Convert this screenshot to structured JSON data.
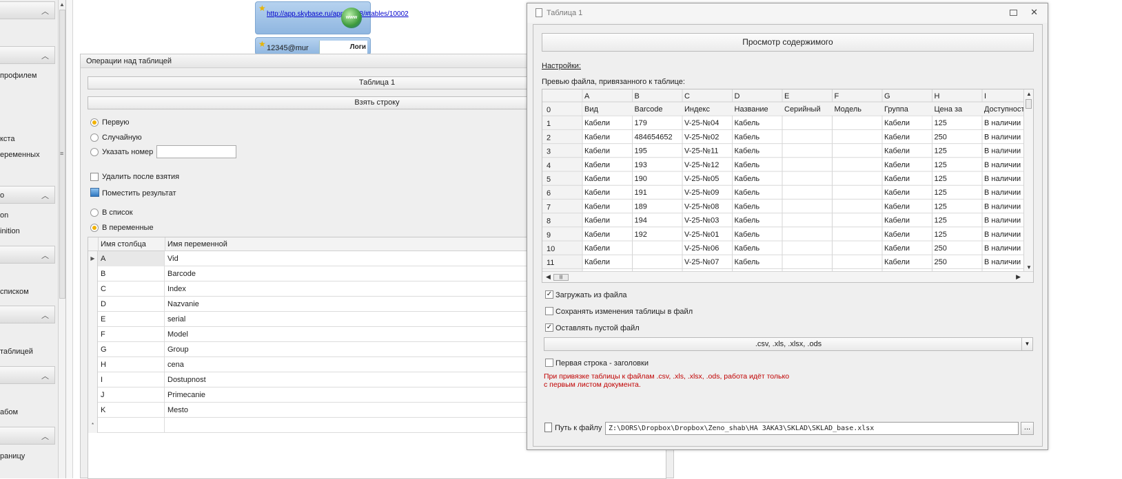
{
  "sidebar": {
    "items": [
      "профилем",
      "кста",
      "еременных",
      "о",
      "on",
      "inition",
      "списком",
      "таблицей",
      "абом",
      "раницу"
    ]
  },
  "cards": {
    "link": "http://app.skybase.ru/app27378/#tables/10002",
    "globe": "www",
    "user": "12345@mur",
    "login": "Логи"
  },
  "ops": {
    "title": "Операции над таблицей",
    "table_name": "Таблица 1",
    "take_row": "Взять строку",
    "radio_first": "Первую",
    "radio_random": "Случайную",
    "radio_number": "Указать номер",
    "delete_after": "Удалить после взятия",
    "put_result": "Поместить результат",
    "to_list": "В список",
    "to_vars": "В переменные",
    "grid_headers": [
      "Имя столбца",
      "Имя переменной"
    ],
    "grid_rows": [
      [
        "A",
        "Vid"
      ],
      [
        "B",
        "Barcode"
      ],
      [
        "C",
        "Index"
      ],
      [
        "D",
        "Nazvanie"
      ],
      [
        "E",
        "serial"
      ],
      [
        "F",
        "Model"
      ],
      [
        "G",
        "Group"
      ],
      [
        "H",
        "cena"
      ],
      [
        "I",
        "Dostupnost"
      ],
      [
        "J",
        "Primecanie"
      ],
      [
        "K",
        "Mesto"
      ]
    ],
    "new_row_marker": "*"
  },
  "dialog": {
    "title": "Таблица 1",
    "view_button": "Просмотр содержимого",
    "settings_link": "Настройки:",
    "preview_label": "Превью файла, привязанного к таблице:",
    "preview": {
      "col_letters": [
        "A",
        "B",
        "C",
        "D",
        "E",
        "F",
        "G",
        "H",
        "I"
      ],
      "row_numbers": [
        "0",
        "1",
        "2",
        "3",
        "4",
        "5",
        "6",
        "7",
        "8",
        "9",
        "10",
        "11"
      ],
      "rows": [
        [
          "Вид",
          "Barcode",
          "Индекс",
          "Название",
          "Серийный",
          "Модель",
          "Группа",
          "Цена за",
          "Доступност"
        ],
        [
          "Кабели",
          "179",
          "V-25-№04",
          "Кабель",
          "",
          "",
          "Кабели",
          "125",
          "В наличии"
        ],
        [
          "Кабели",
          "484654652",
          "V-25-№02",
          "Кабель",
          "",
          "",
          "Кабели",
          "250",
          "В наличии"
        ],
        [
          "Кабели",
          "195",
          "V-25-№11",
          "Кабель",
          "",
          "",
          "Кабели",
          "125",
          "В наличии"
        ],
        [
          "Кабели",
          "193",
          "V-25-№12",
          "Кабель",
          "",
          "",
          "Кабели",
          "125",
          "В наличии"
        ],
        [
          "Кабели",
          "190",
          "V-25-№05",
          "Кабель",
          "",
          "",
          "Кабели",
          "125",
          "В наличии"
        ],
        [
          "Кабели",
          "191",
          "V-25-№09",
          "Кабель",
          "",
          "",
          "Кабели",
          "125",
          "В наличии"
        ],
        [
          "Кабели",
          "189",
          "V-25-№08",
          "Кабель",
          "",
          "",
          "Кабели",
          "125",
          "В наличии"
        ],
        [
          "Кабели",
          "194",
          "V-25-№03",
          "Кабель",
          "",
          "",
          "Кабели",
          "125",
          "В наличии"
        ],
        [
          "Кабели",
          "192",
          "V-25-№01",
          "Кабель",
          "",
          "",
          "Кабели",
          "125",
          "В наличии"
        ],
        [
          "Кабели",
          "",
          "V-25-№06",
          "Кабель",
          "",
          "",
          "Кабели",
          "250",
          "В наличии"
        ],
        [
          "Кабели",
          "",
          "V-25-№07",
          "Кабель",
          "",
          "",
          "Кабели",
          "250",
          "В наличии"
        ]
      ]
    },
    "load_from_file": "Загружать из файла",
    "save_changes": "Сохранять изменения таблицы в файл",
    "keep_empty": "Оставлять пустой файл",
    "extensions": ".csv, .xls, .xlsx, .ods",
    "first_row_headers": "Первая строка - заголовки",
    "warning": "При привязке таблицы к файлам .csv, .xls, .xlsx, .ods, работа идёт только с первым листом документа.",
    "path_label": "Путь к файлу",
    "path_value": "Z:\\DORS\\Dropbox\\Dropbox\\Zeno_shab\\НА ЗАКАЗ\\SKLAD\\SKLAD_base.xlsx",
    "browse": "..."
  },
  "colors": {
    "radio_selected": "#f0b100",
    "warning": "#c00000",
    "link": "#0000cc"
  }
}
